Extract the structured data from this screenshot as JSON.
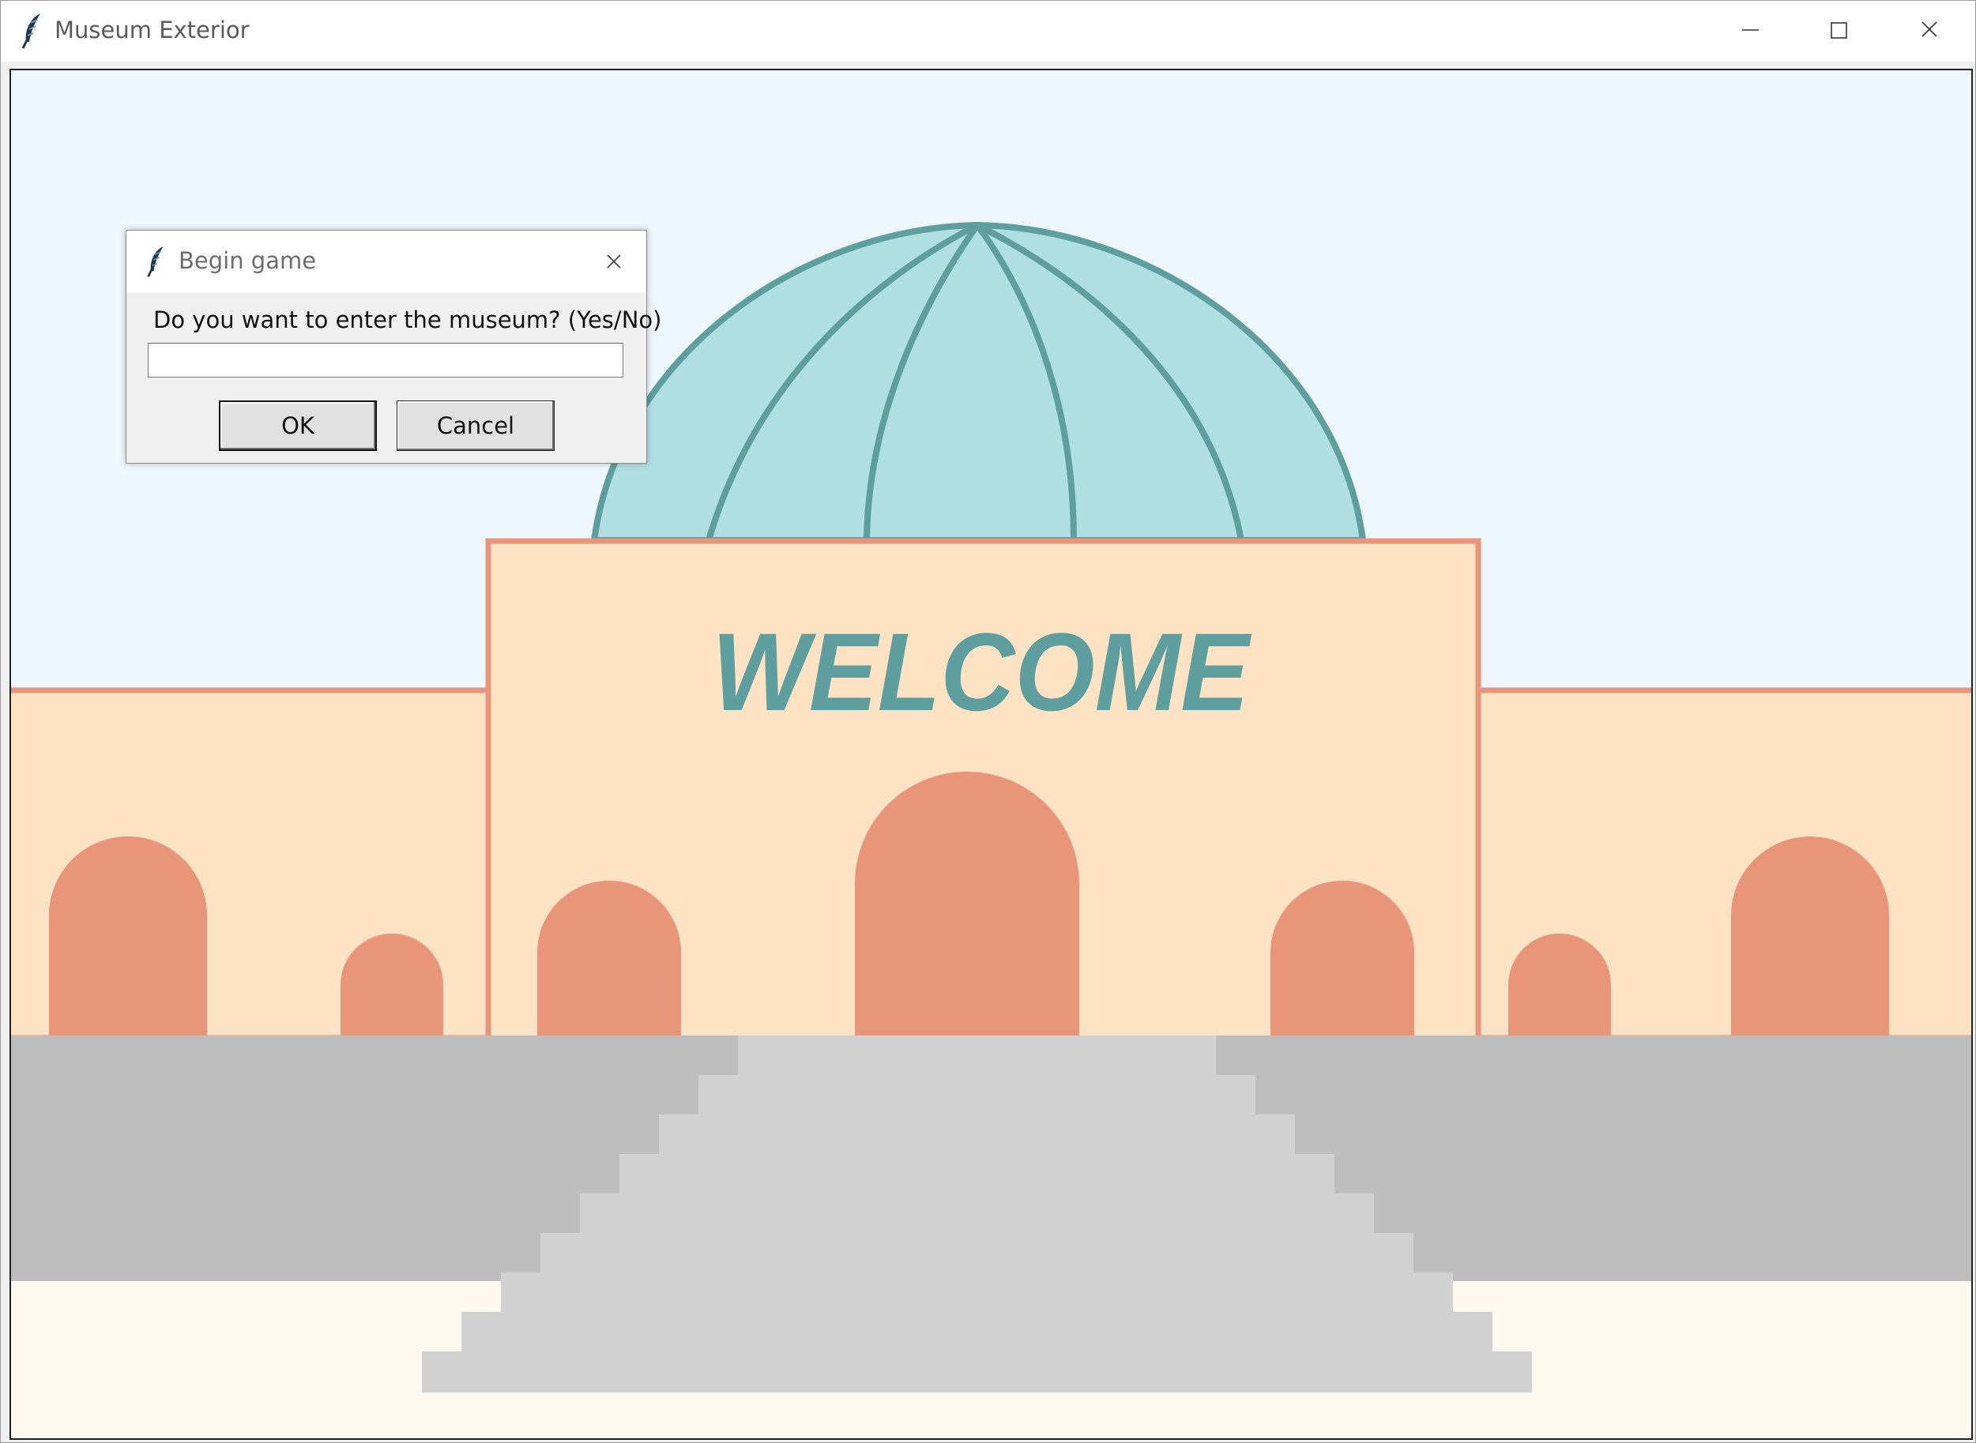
{
  "window": {
    "title": "Museum Exterior",
    "app_icon": "feather-icon",
    "controls": [
      "minimize-icon",
      "maximize-icon",
      "close-icon"
    ]
  },
  "scene": {
    "sign_text": "WELCOME",
    "colors": {
      "sky": "#eef7fd",
      "dome_fill": "#b0dfe3",
      "dome_lines": "#5e9e9e",
      "wall": "#fde3c4",
      "wall_outline": "#e8957a",
      "arch": "#e8957a",
      "sign_text": "#5e9e9e",
      "plaza": "#bdbdbd",
      "stairs": "#d1d1d1",
      "ground": "#fdf9ef"
    }
  },
  "dialog": {
    "title": "Begin game",
    "icon": "feather-icon",
    "prompt": "Do you want to enter the museum? (Yes/No)",
    "input_value": "",
    "ok_label": "OK",
    "cancel_label": "Cancel"
  }
}
